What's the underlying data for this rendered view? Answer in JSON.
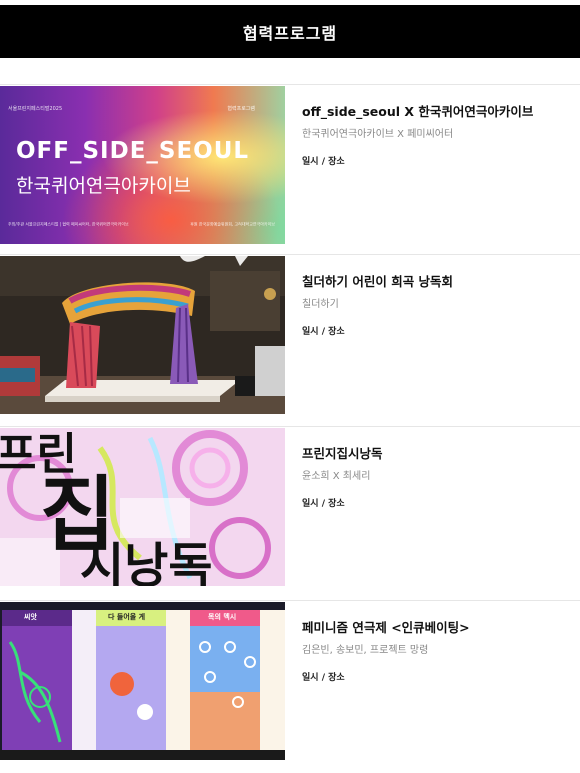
{
  "header": {
    "title": "협력프로그램"
  },
  "meta_label": "일시 / 장소",
  "items": [
    {
      "title": "off_side_seoul X 한국퀴어연극아카이브",
      "subtitle": "한국퀴어연극아카이브 X 페미씨어터",
      "thumb": {
        "top_left": "서울프린지페스티벌2025",
        "top_right": "협력프로그램",
        "line1": "OFF_SIDE_SEOUL",
        "line2": "한국퀴어연극아카이브",
        "bottom_left": "주최/주관 서울프린지페스티벌 | 협력 페미씨어터, 한국퀴어연극아카이브",
        "bottom_right": "후원 한국문화예술위원회, 고려대학교연극아카이브"
      }
    },
    {
      "title": "칠더하기 어린이 희곡 낭독회",
      "subtitle": "칠더하기"
    },
    {
      "title": "프린지집시낭독",
      "subtitle": "윤소희 X 최세리",
      "thumb": {
        "c1": "프린",
        "c2": "집",
        "c3": "시낭독"
      }
    },
    {
      "title": "페미니즘 연극제 <인큐베이팅>",
      "subtitle": "김은빈, 송보민, 프로젝트 망령",
      "thumb": {
        "p1": "씨앗",
        "p2": "다 들어올 게",
        "p3": "목의 멕시"
      }
    }
  ],
  "colors": {
    "header_bg": "#000000",
    "accent": "#111111"
  }
}
